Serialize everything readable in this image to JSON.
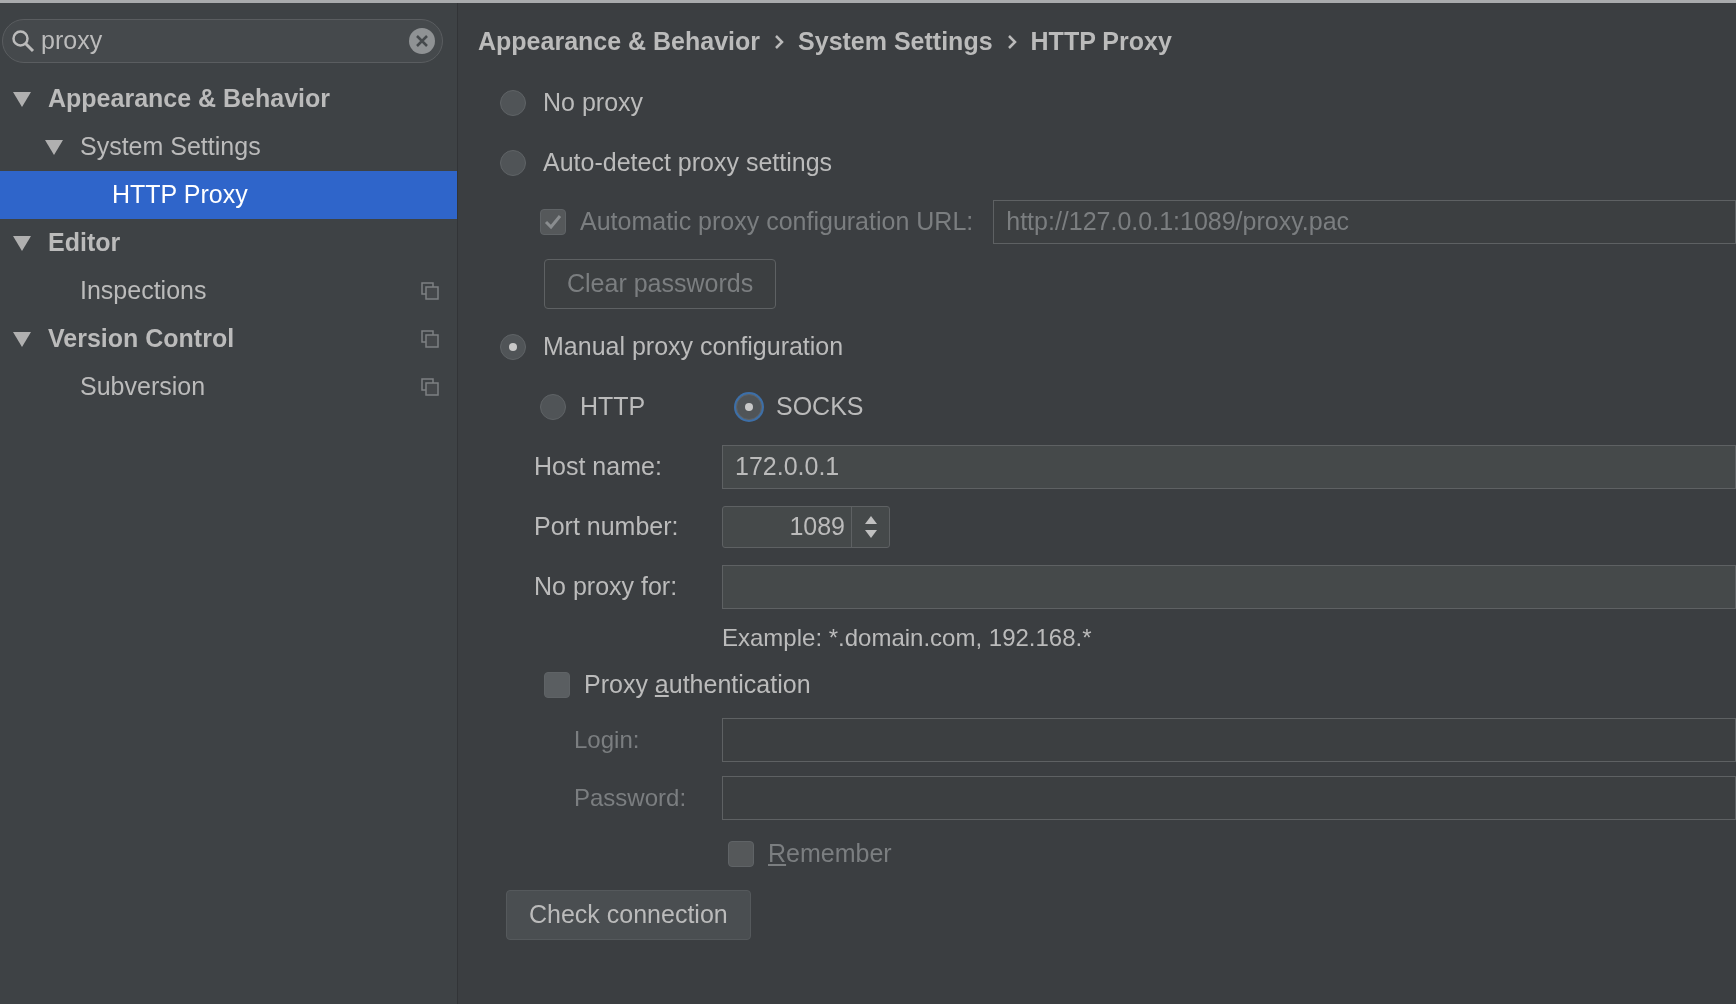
{
  "search": {
    "value": "proxy"
  },
  "tree": [
    {
      "label": "Appearance & Behavior",
      "expanded": true,
      "selected": false,
      "copy_icon": false,
      "children": [
        {
          "label": "System Settings",
          "expanded": true,
          "selected": false,
          "copy_icon": false,
          "children": [
            {
              "label": "HTTP Proxy",
              "selected": true,
              "copy_icon": false
            }
          ]
        }
      ]
    },
    {
      "label": "Editor",
      "expanded": true,
      "selected": false,
      "copy_icon": false,
      "children": [
        {
          "label": "Inspections",
          "selected": false,
          "copy_icon": true
        }
      ]
    },
    {
      "label": "Version Control",
      "expanded": true,
      "selected": false,
      "copy_icon": true,
      "children": [
        {
          "label": "Subversion",
          "selected": false,
          "copy_icon": true
        }
      ]
    }
  ],
  "breadcrumb": [
    "Appearance & Behavior",
    "System Settings",
    "HTTP Proxy"
  ],
  "proxy_modes": [
    {
      "label": "No proxy",
      "selected": false
    },
    {
      "label": "Auto-detect proxy settings",
      "selected": false
    },
    {
      "label": "Manual proxy configuration",
      "selected": true
    }
  ],
  "auto_detect": {
    "pac_checkbox": {
      "label": "Automatic proxy configuration URL:",
      "checked": true,
      "disabled": true
    },
    "pac_url": {
      "value": "http://127.0.0.1:1089/proxy.pac",
      "disabled": true
    },
    "clear_passwords": {
      "label": "Clear passwords",
      "disabled": true
    }
  },
  "manual": {
    "protocols": [
      {
        "label": "HTTP",
        "selected": false
      },
      {
        "label": "SOCKS",
        "selected": true
      }
    ],
    "host": {
      "label": "Host name:",
      "value": "172.0.0.1"
    },
    "port": {
      "label": "Port number:",
      "value": "1089"
    },
    "no_proxy": {
      "label": "No proxy for:"
    },
    "example": "Example: *.domain.com, 192.168.*",
    "auth": {
      "before": "Proxy ",
      "key": "a",
      "after": "uthentication",
      "checked": false
    },
    "login": {
      "label": "Login:",
      "disabled": true
    },
    "password": {
      "label": "Password:",
      "disabled": true
    },
    "remember": {
      "key": "R",
      "after": "emember",
      "checked": false,
      "disabled": true
    }
  },
  "check_button": "Check connection"
}
